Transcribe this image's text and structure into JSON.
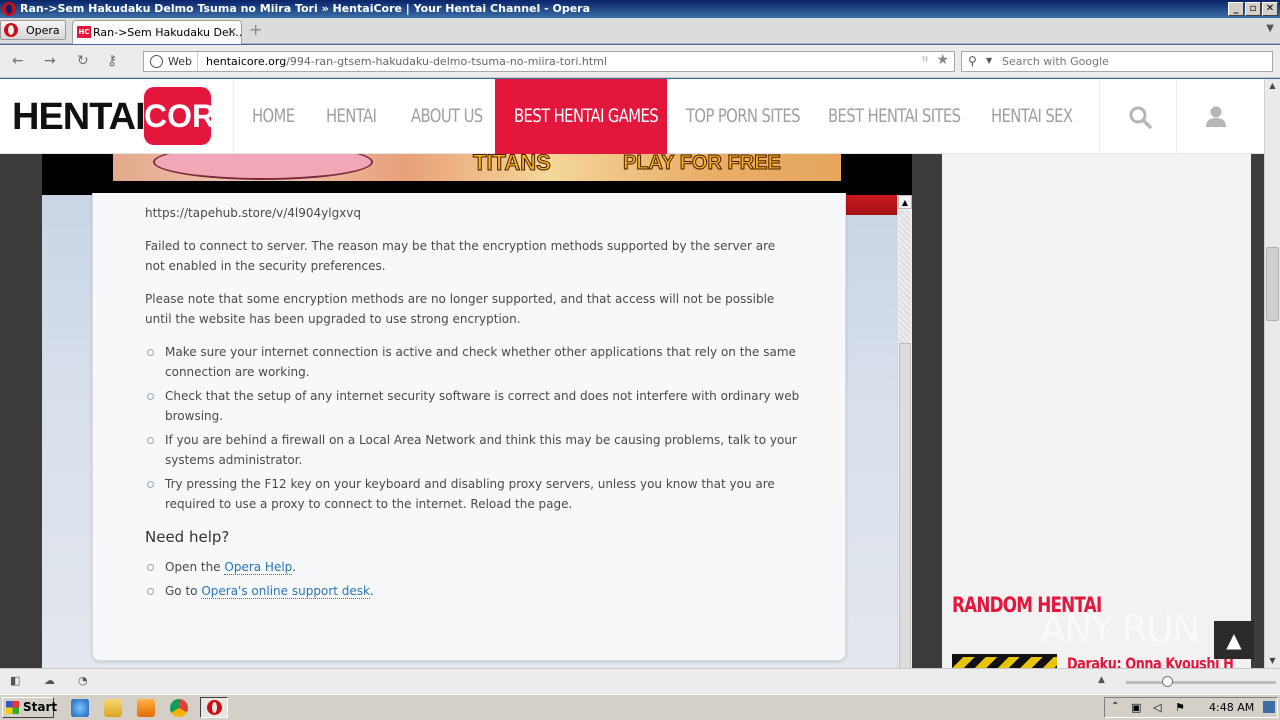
{
  "window": {
    "title": "Ran->Sem Hakudaku Delmo Tsuma no Miira Tori » HentaiCore | Your Hentai Channel - Opera",
    "minimize": "_",
    "maximize": "▫",
    "close": "✕"
  },
  "tabs": {
    "menu_label": "Opera",
    "active_tab_label": "Ran->Sem Hakudaku Del...",
    "favicon_text": "HC",
    "close_glyph": "✕",
    "new_tab_glyph": "+"
  },
  "addressbar": {
    "web_label": "Web",
    "url_domain": "hentaicore.org",
    "url_path": "/994-ran-gtsem-hakudaku-delmo-tsuma-no-miira-tori.html",
    "search_placeholder": "Search with Google"
  },
  "site": {
    "logo_part1": "HENTAI",
    "logo_part2": "CORE",
    "nav": [
      {
        "label": "HOME"
      },
      {
        "label": "HENTAI"
      },
      {
        "label": "ABOUT US"
      },
      {
        "label": "BEST HENTAI GAMES",
        "active": true
      },
      {
        "label": "TOP PORN SITES"
      },
      {
        "label": "BEST HENTAI SITES"
      },
      {
        "label": "HENTAI SEX"
      }
    ],
    "accent_color": "#e3173d"
  },
  "banner": {
    "text_left": "TITANS",
    "text_right": "PLAY FOR FREE"
  },
  "error": {
    "url": "https://tapehub.store/v/4l904ylgxvq",
    "p1": "Failed to connect to server. The reason may be that the encryption methods supported by the server are not enabled in the security preferences.",
    "p2": "Please note that some encryption methods are no longer supported, and that access will not be possible until the website has been upgraded to use strong encryption.",
    "bullets": [
      "Make sure your internet connection is active and check whether other applications that rely on the same connection are working.",
      "Check that the setup of any internet security software is correct and does not interfere with ordinary web browsing.",
      "If you are behind a firewall on a Local Area Network and think this may be causing problems, talk to your systems administrator.",
      "Try pressing the F12 key on your keyboard and disabling proxy servers, unless you know that you are required to use a proxy to connect to the internet. Reload the page."
    ],
    "help_heading": "Need help?",
    "help1_prefix": "Open the ",
    "help1_link": "Opera Help",
    "help1_suffix": ".",
    "help2_prefix": "Go to ",
    "help2_link": "Opera's online support desk",
    "help2_suffix": "."
  },
  "sidebar": {
    "random_heading": "RANDOM HENTAI",
    "random_item_title": "Daraku: Onna Kyoushi H",
    "back_to_top": "▲"
  },
  "watermark": "ANY RUN",
  "taskbar": {
    "start_label": "Start",
    "clock": "4:48 AM"
  }
}
